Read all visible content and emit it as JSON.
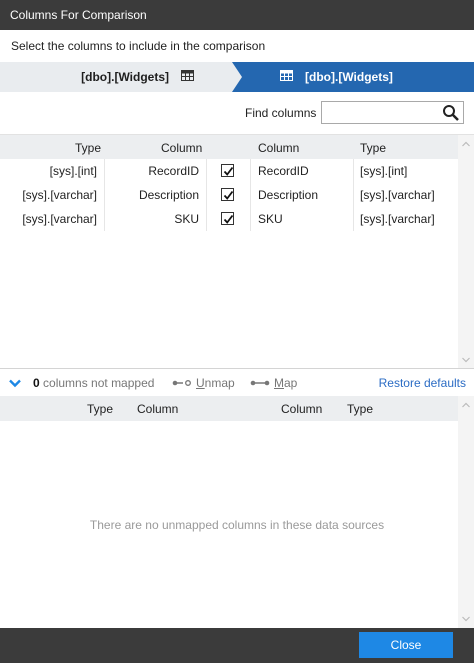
{
  "window": {
    "title": "Columns For Comparison"
  },
  "instruction": "Select the columns to include in the comparison",
  "sources": {
    "left": {
      "name": "[dbo].[Widgets]",
      "icon": "table-icon"
    },
    "right": {
      "name": "[dbo].[Widgets]",
      "icon": "table-icon"
    }
  },
  "find": {
    "label": "Find columns",
    "value": "",
    "icon": "search-icon"
  },
  "mapped_grid": {
    "headers": {
      "left_type": "Type",
      "left_column": "Column",
      "right_column": "Column",
      "right_type": "Type"
    },
    "rows": [
      {
        "left_type": "[sys].[int]",
        "left_column": "RecordID",
        "checked": true,
        "right_column": "RecordID",
        "right_type": "[sys].[int]"
      },
      {
        "left_type": "[sys].[varchar]",
        "left_column": "Description",
        "checked": true,
        "right_column": "Description",
        "right_type": "[sys].[varchar]"
      },
      {
        "left_type": "[sys].[varchar]",
        "left_column": "SKU",
        "checked": true,
        "right_column": "SKU",
        "right_type": "[sys].[varchar]"
      }
    ]
  },
  "unmapped_toolbar": {
    "count": "0",
    "count_label": "columns not mapped",
    "unmap_prefix": "",
    "unmap_underlined": "U",
    "unmap_rest": "nmap",
    "map_underlined": "M",
    "map_rest": "ap",
    "restore_label": "Restore defaults"
  },
  "unmapped_grid": {
    "headers": {
      "left_type": "Type",
      "left_column": "Column",
      "right_column": "Column",
      "right_type": "Type"
    },
    "empty_message": "There are no unmapped columns in these data sources"
  },
  "footer": {
    "close_label": "Close"
  },
  "colors": {
    "titlebar": "#3b3b3b",
    "accent": "#1e88e5",
    "target_bar": "#2467b0",
    "link": "#2b6cc4"
  }
}
